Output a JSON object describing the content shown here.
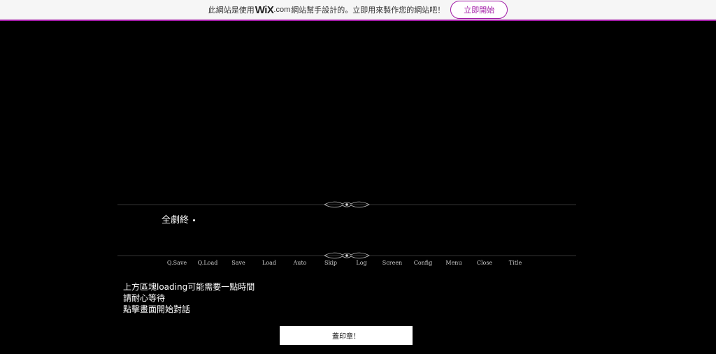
{
  "wix_banner": {
    "text_before": "此網站是使用",
    "logo": "WiX",
    "logo_suffix": ".com",
    "text_after": "網站幫手設計的。立即用來製作您的網站吧！",
    "cta_label": "立即開始",
    "accent_color": "#a11aa6"
  },
  "game": {
    "dialog_text": "全劇終",
    "menu": [
      "Q.Save",
      "Q.Load",
      "Save",
      "Load",
      "Auto",
      "Skip",
      "Log",
      "Screen",
      "Config",
      "Menu",
      "Close",
      "Title"
    ],
    "ornament_icon": "scroll-flourish-icon"
  },
  "notes": {
    "line1": "上方區塊loading可能需要一點時間",
    "line2": "請耐心等待",
    "line3": "點擊畫面開始對話"
  },
  "stamp_button_label": "蓋印章！"
}
